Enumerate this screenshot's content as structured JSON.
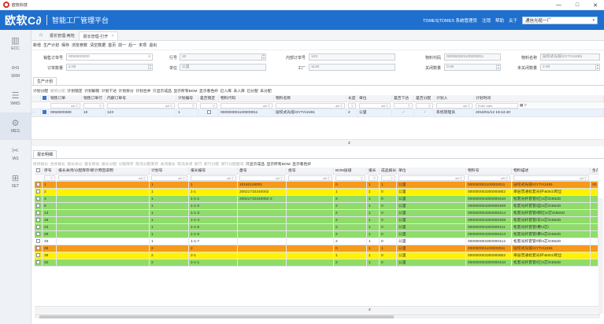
{
  "window": {
    "title": "欧软科技",
    "controls": [
      "—",
      "□",
      "✕"
    ]
  },
  "header": {
    "brand": "欧软C∂",
    "platform": "智能工厂管理平台",
    "user_text": "TDMES|TDMES 系统管理员",
    "logout": "注销",
    "help": "帮助",
    "about": "关于",
    "org_value": "通信光缆一厂"
  },
  "sidebar": {
    "items": [
      {
        "label": "ECC",
        "icon": "bar-chart-icon"
      },
      {
        "label": "SRM",
        "icon": "network-icon"
      },
      {
        "label": "WMS",
        "icon": "warehouse-icon"
      },
      {
        "label": "MES",
        "icon": "gear-icon"
      },
      {
        "label": "IAS",
        "icon": "tools-icon"
      },
      {
        "label": "SET",
        "icon": "grid-icon"
      }
    ]
  },
  "tabs": [
    {
      "label": "报长管理-两地"
    },
    {
      "label": "报长管理-打开"
    }
  ],
  "toolbar": [
    "新增",
    "生产计划",
    "保存",
    "浏览参数",
    "清空数据",
    "首页",
    "前一",
    "后一",
    "末项",
    "退出"
  ],
  "form": {
    "sales_order_no": {
      "label": "销售订单号",
      "value": "0050000300"
    },
    "line_no": {
      "label": "行号",
      "value": "10"
    },
    "internal_order_no": {
      "label": "内部订单号",
      "value": "123"
    },
    "material_code": {
      "label": "物料代码",
      "value": "000000001100000011"
    },
    "material_name": {
      "label": "物料名称",
      "value": "层绞式光缆\\GYTA\\24B1"
    },
    "order_qty": {
      "label": "订单数量",
      "value": "2.00"
    },
    "unit": {
      "label": "单位",
      "value": "公里"
    },
    "factory": {
      "label": "工厂",
      "value": "1120"
    },
    "closed_qty": {
      "label": "关闭数量",
      "value": "0.00"
    },
    "unclosed_qty": {
      "label": "未关闭数量",
      "value": "2.00"
    }
  },
  "plan_section": {
    "tab": "生产计划",
    "actions": [
      {
        "label": "计划分配",
        "enabled": true
      },
      {
        "label": "撤销分配",
        "enabled": false
      },
      {
        "label": "计划锁定",
        "enabled": true
      },
      {
        "label": "计划解锁",
        "enabled": true
      },
      {
        "label": "计划下达",
        "enabled": true
      },
      {
        "label": "计划拆分",
        "enabled": true
      },
      {
        "label": "计划合并",
        "enabled": true
      },
      {
        "label": "只显示成品",
        "enabled": true
      },
      {
        "label": "显示所有BOM",
        "enabled": true
      },
      {
        "label": "显示看色纤",
        "enabled": true
      },
      {
        "label": "已入库",
        "enabled": true
      },
      {
        "label": "未入库",
        "enabled": true
      },
      {
        "label": "已分配",
        "enabled": true
      },
      {
        "label": "未分配",
        "enabled": true
      }
    ],
    "columns": [
      "",
      "",
      "销售订单",
      "销售订单行",
      "内部订单号",
      "计划编号",
      "是否锁定",
      "物料代码",
      "物料名称",
      "长度",
      "单位",
      "是否下达",
      "是否分配",
      "计划人",
      "计划时间"
    ],
    "filter_placeholder": "Enter date",
    "rows": [
      {
        "sales_order": "0050000380",
        "line": "10",
        "internal": "123",
        "plan_no": "1",
        "material_code": "000000001100000011",
        "material_name": "层绞式光缆\\GYTA\\2481",
        "length": "2",
        "unit": "公里",
        "planner": "系统管理员",
        "plan_time": "2018/01/12 19:44:40"
      }
    ],
    "total": "2"
  },
  "detail_section": {
    "tab": "报长明细",
    "actions": [
      {
        "label": "修改报长",
        "enabled": false
      },
      {
        "label": "合并报长",
        "enabled": false
      },
      {
        "label": "报长拆分",
        "enabled": false
      },
      {
        "label": "报长移动",
        "enabled": false
      },
      {
        "label": "报长分配",
        "enabled": false
      },
      {
        "label": "分配库存",
        "enabled": false
      },
      {
        "label": "取消分配库存",
        "enabled": false
      },
      {
        "label": "关闭报长",
        "enabled": false
      },
      {
        "label": "取消关闭",
        "enabled": false
      },
      {
        "label": "新行",
        "enabled": false
      },
      {
        "label": "新行分配",
        "enabled": false
      },
      {
        "label": "新行分配盘号",
        "enabled": false
      },
      {
        "label": "只显示成品",
        "enabled": true
      },
      {
        "label": "显示所有BOM",
        "enabled": true
      },
      {
        "label": "显示看色纤",
        "enabled": true
      }
    ],
    "columns": [
      "",
      "序号",
      "报长关闭/分配库存/新计原因说明",
      "计划号",
      "报长编号",
      "盘号",
      "批号",
      "BOM层级",
      "报长",
      "成品报长",
      "单位",
      "物料号",
      "物料描述",
      "生产"
    ],
    "rows": [
      {
        "seq": "1",
        "plan": "1",
        "length_no": "1",
        "reel": "20180118001",
        "batch": "",
        "bom": "0",
        "len": "1",
        "fin": "1",
        "unit": "公里",
        "mat": "000000001100000011",
        "desc": "层绞式光缆\\GYTA\\2481",
        "prod": "00",
        "color": "orange"
      },
      {
        "seq": "2",
        "plan": "1",
        "length_no": "1-1",
        "reel": "20021710240002",
        "batch": "",
        "bom": "1",
        "len": "1",
        "fin": "0",
        "unit": "公里",
        "mat": "000000003300000802",
        "desc": "单层普通松套光纤\\6081\\跨丝",
        "prod": "",
        "color": "yellow"
      },
      {
        "seq": "3",
        "plan": "1",
        "length_no": "1-1-1",
        "reel": "20021710240002-2",
        "batch": "",
        "bom": "2",
        "len": "1",
        "fin": "0",
        "unit": "公里",
        "mat": "000000003300000410",
        "desc": "松套光纤套管\\红\\4芯\\G652D",
        "prod": "",
        "color": "green"
      },
      {
        "seq": "8",
        "plan": "1",
        "length_no": "1-1-2",
        "reel": "",
        "batch": "",
        "bom": "2",
        "len": "1",
        "fin": "0",
        "unit": "公里",
        "mat": "000000003300000409",
        "desc": "松套光纤套管\\蓝\\4芯\\G652D",
        "prod": "",
        "color": "green"
      },
      {
        "seq": "13",
        "plan": "1",
        "length_no": "1-1-3",
        "reel": "",
        "batch": "",
        "bom": "2",
        "len": "1",
        "fin": "0",
        "unit": "公里",
        "mat": "000000003300000414",
        "desc": "松套光纤套管\\棕红\\4芯\\G652D",
        "prod": "",
        "color": "green"
      },
      {
        "seq": "18",
        "plan": "1",
        "length_no": "1-1-4",
        "reel": "",
        "batch": "",
        "bom": "2",
        "len": "1",
        "fin": "0",
        "unit": "公里",
        "mat": "000000003300000408",
        "desc": "松套光纤套管\\灰\\4芯\\G652D",
        "prod": "",
        "color": "green"
      },
      {
        "seq": "23",
        "plan": "1",
        "length_no": "1-1-5",
        "reel": "",
        "batch": "",
        "bom": "2",
        "len": "1",
        "fin": "0",
        "unit": "公里",
        "mat": "000000003300000411",
        "desc": "松套光纤套管\\黄\\4芯\\",
        "prod": "",
        "color": "green"
      },
      {
        "seq": "28",
        "plan": "1",
        "length_no": "1-1-6",
        "reel": "",
        "batch": "",
        "bom": "2",
        "len": "1",
        "fin": "0",
        "unit": "公里",
        "mat": "000000003300000413",
        "desc": "松套光纤套管\\黄\\4芯\\G652D",
        "prod": "",
        "color": "green"
      },
      {
        "seq": "33",
        "plan": "1",
        "length_no": "1-1-7",
        "reel": "",
        "batch": "",
        "bom": "2",
        "len": "1",
        "fin": "0",
        "unit": "公里",
        "mat": "000000003300000412",
        "desc": "松套光纤套管\\绿\\4芯\\G652D",
        "prod": "",
        "color": "white"
      },
      {
        "seq": "38",
        "plan": "2",
        "length_no": "2",
        "reel": "",
        "batch": "",
        "bom": "0",
        "len": "1",
        "fin": "1",
        "unit": "公里",
        "mat": "000000001100000011",
        "desc": "层绞式光缆\\GYTA\\2481",
        "prod": "",
        "color": "orange"
      },
      {
        "seq": "39",
        "plan": "2",
        "length_no": "2-1",
        "reel": "",
        "batch": "",
        "bom": "1",
        "len": "1",
        "fin": "0",
        "unit": "公里",
        "mat": "000000003300000802",
        "desc": "单层普通松套光纤\\6081\\跨丝",
        "prod": "",
        "color": "yellow"
      },
      {
        "seq": "40",
        "plan": "2",
        "length_no": "2-1-1",
        "reel": "",
        "batch": "",
        "bom": "2",
        "len": "1",
        "fin": "0",
        "unit": "公里",
        "mat": "000000003300000410",
        "desc": "松套光纤套管\\红\\4芯\\G652D",
        "prod": "",
        "color": "green"
      }
    ],
    "total": "2"
  },
  "colors": {
    "brand": "#1f6fcf",
    "orange": "#f59a1b",
    "yellow": "#fff200",
    "green": "#8fdc6a"
  }
}
